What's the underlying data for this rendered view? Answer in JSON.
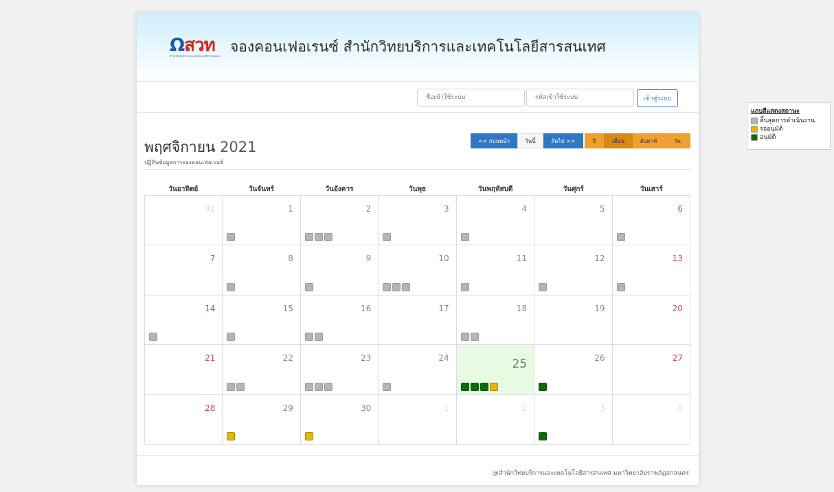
{
  "colors": {
    "finished": "#b5b5b5",
    "pending": "#e4b800",
    "approved": "#0d6b0d"
  },
  "header": {
    "logo_text_a": "Ω",
    "logo_text_b": "สวท",
    "logo_sub": "สำนักวิทยบริการและเทคโนโลยีสารสนเทศ",
    "title": "จองคอนเฟอเรนซ์ สำนักวิทยบริการและเทคโนโลยีสารสนเทศ"
  },
  "login": {
    "username_placeholder": "ชื่อเข้าใช้ระบบ",
    "password_placeholder": "รหัสเข้าใช้ระบบ",
    "login_label": "เข้าสู่ระบบ"
  },
  "calendar": {
    "month": "พฤศจิกายน",
    "year": "2021",
    "subtitle": "ปฏิทินข้อมูลการจองคอนเฟอเรนซ์",
    "nav": {
      "prev": "<< ก่อนหน้า",
      "today": "วันนี้",
      "next": "ถัดไป >>"
    },
    "views": [
      "ปี",
      "เดือน",
      "สัปดาห์",
      "วัน"
    ],
    "active_view": 1,
    "dow": [
      "วันอาทิตย์",
      "วันจันทร์",
      "วันอังคาร",
      "วันพุธ",
      "วันพฤหัสบดี",
      "วันศุกร์",
      "วันเสาร์"
    ],
    "weeks": [
      [
        {
          "d": "31",
          "o": 1,
          "m": []
        },
        {
          "d": "1",
          "m": [
            "f"
          ]
        },
        {
          "d": "2",
          "m": [
            "f",
            "f",
            "f"
          ]
        },
        {
          "d": "3",
          "m": [
            "f"
          ]
        },
        {
          "d": "4",
          "m": [
            "f"
          ]
        },
        {
          "d": "5",
          "m": []
        },
        {
          "d": "6",
          "m": [
            "f"
          ]
        }
      ],
      [
        {
          "d": "7",
          "m": []
        },
        {
          "d": "8",
          "m": [
            "f"
          ]
        },
        {
          "d": "9",
          "m": [
            "f"
          ]
        },
        {
          "d": "10",
          "m": [
            "f",
            "f",
            "f"
          ]
        },
        {
          "d": "11",
          "m": [
            "f"
          ]
        },
        {
          "d": "12",
          "m": [
            "f"
          ]
        },
        {
          "d": "13",
          "m": [
            "f"
          ]
        }
      ],
      [
        {
          "d": "14",
          "m": [
            "f"
          ]
        },
        {
          "d": "15",
          "m": [
            "f"
          ]
        },
        {
          "d": "16",
          "m": [
            "f",
            "f"
          ]
        },
        {
          "d": "17",
          "m": []
        },
        {
          "d": "18",
          "m": [
            "f",
            "f"
          ]
        },
        {
          "d": "19",
          "m": []
        },
        {
          "d": "20",
          "m": []
        }
      ],
      [
        {
          "d": "21",
          "m": []
        },
        {
          "d": "22",
          "m": [
            "f",
            "f"
          ]
        },
        {
          "d": "23",
          "m": [
            "f",
            "f",
            "f"
          ]
        },
        {
          "d": "24",
          "m": [
            "f"
          ]
        },
        {
          "d": "25",
          "t": 1,
          "m": [
            "a",
            "a",
            "a",
            "p"
          ]
        },
        {
          "d": "26",
          "m": [
            "a"
          ]
        },
        {
          "d": "27",
          "m": []
        }
      ],
      [
        {
          "d": "28",
          "m": []
        },
        {
          "d": "29",
          "m": [
            "p"
          ]
        },
        {
          "d": "30",
          "m": [
            "p"
          ]
        },
        {
          "d": "1",
          "o": 1,
          "m": []
        },
        {
          "d": "2",
          "o": 1,
          "m": []
        },
        {
          "d": "3",
          "o": 1,
          "m": [
            "a"
          ]
        },
        {
          "d": "4",
          "o": 1,
          "m": []
        }
      ]
    ]
  },
  "legend": {
    "title": "แถบสีแสดงสถานะ",
    "items": [
      {
        "label": "สิ้นสุดการดำเนินงาน",
        "status": "f"
      },
      {
        "label": "รออนุมัติ",
        "status": "p"
      },
      {
        "label": "อนุมัติ",
        "status": "a"
      }
    ]
  },
  "footer": {
    "text": "@สำนักวิทยบริการและเทคโนโลยีสารสนเทศ มหาวิทยาลัยราชภัฏสกลนคร"
  }
}
